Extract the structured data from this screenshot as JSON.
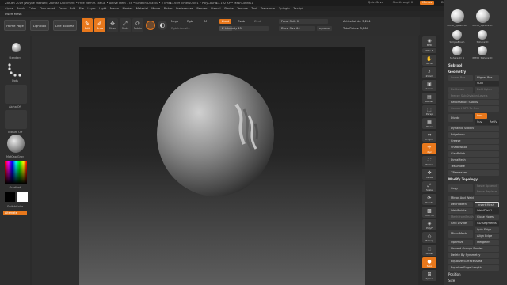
{
  "titlebar": {
    "text": "ZBrush 2019 [Wayne Maxwell]   ZBrush Document   • Free Mem 9.786GB • Active Mem 778 • Scratch Disk 50 • ZTime▸1.609 Timer▸0.001 • PolyCount▸3.192 KP • MeshCount▸1",
    "quicksave": "QuickSave",
    "seethrough": "See-through  0",
    "menus_label": "Menus",
    "script": "DefaultZScript"
  },
  "menus": [
    "Alpha",
    "Brush",
    "Color",
    "Document",
    "Draw",
    "Edit",
    "File",
    "Layer",
    "Light",
    "Macro",
    "Marker",
    "Material",
    "Movie",
    "Picker",
    "Preferences",
    "Render",
    "Stencil",
    "Stroke",
    "Texture",
    "Tool",
    "Transform",
    "Zplugin",
    "Zscript"
  ],
  "insert_mesh": "Insert Mesh",
  "toolbar": {
    "home_page": "Home Page",
    "lightbox": "LightBox",
    "live_boolean": "Live Boolean",
    "edit": "Edit",
    "draw": "Draw",
    "move": "Move",
    "scale": "Scale",
    "rotate": "Rotate",
    "mrgb": "Mrgb",
    "rgb": "Rgb",
    "m": "M",
    "rgb_intensity": "Rgb Intensity",
    "zadd": "Zadd",
    "zsub": "Zsub",
    "zcut": "Zcut",
    "z_intensity": "Z Intensity 25",
    "focal_shift": "Focal Shift 0",
    "draw_size": "Draw Size 64",
    "dynamic": "Dynamic",
    "active_points": "ActivePoints: 3,264",
    "total_points": "TotalPoints: 3,264"
  },
  "left": {
    "brush": "Standard",
    "stroke": "Dots",
    "alpha": "Alpha Off",
    "texture": "Texture Off",
    "material": "MatCap Gray",
    "gradient": "Gradient",
    "switch_color": "SwitchColor",
    "alternate": "Alternate"
  },
  "right_icons": [
    "BPR",
    "SPix 3",
    "Scroll",
    "Zoom",
    "Actual",
    "AAHalf",
    "Persp",
    "Floor",
    "L.Sym",
    "Xyz",
    "Frame",
    "Move",
    "Scale",
    "Rotate",
    "Line Fill",
    "PolyF",
    "Transp",
    "Ghost",
    "Solo",
    "Xpose"
  ],
  "panel": {
    "mesh_tiles": [
      "PM3D_Sphere3D",
      "SimpleBrush",
      "Sphere3D",
      "Sphere3D_1",
      "PM3D_Sphere3D"
    ],
    "subtool": "Subtool",
    "geometry": "Geometry",
    "lower_res": "Lower Res",
    "higher_res": "Higher Res",
    "sdiv": "SDiv",
    "del_lower": "Del Lower",
    "del_higher": "Del Higher",
    "freeze": "Freeze SubDivision Levels",
    "reconstruct": "Reconstruct Subdiv",
    "convert_bpr": "Convert BPR To Geo",
    "divide": "Divide",
    "smt": "Smt",
    "suv": "Suv",
    "rsmt": "ReUV",
    "dynamic_subdiv": "Dynamic Subdiv",
    "edgeloop": "EdgeLoop",
    "crease": "Crease",
    "shadowbox": "ShadowBox",
    "claypolish": "ClayPolish",
    "dynamesh": "DynaMesh",
    "tessimate": "Tessimate",
    "zremesher": "ZRemesher",
    "modify_topology": "Modify Topology",
    "copy": "Copy",
    "paste_append": "Paste Append",
    "paste_replace": "Paste Replace",
    "mirror_weld": "Mirror And Weld",
    "del_hidden": "Del Hidden",
    "insert_mesh": "Insert Mesh",
    "weld_points": "WeldPoints",
    "weld_dist": "WeldDist 1",
    "meshfrom_brush": "MeshFromBrush",
    "close_holes": "Close Holes",
    "grid_divide": "Grid Divide",
    "gd_segments": "GD Segments 3",
    "micro_mesh": "Micro Mesh",
    "spin_edge": "Spin Edge",
    "align_edge": "Align Edge",
    "optimize_points": "Optimize Points",
    "merge_tris": "MergeTris",
    "unweld_groups": "Unweld Groups Border",
    "delete_symmetry": "Delete By Symmetry",
    "equalize_surface": "Equalize Surface Area",
    "equalize_edge": "Equalize Edge Length",
    "position": "Position",
    "size": "Size"
  },
  "colors": {
    "accent": "#e8781c",
    "panel": "#343434",
    "bg": "#2b2b2b"
  }
}
